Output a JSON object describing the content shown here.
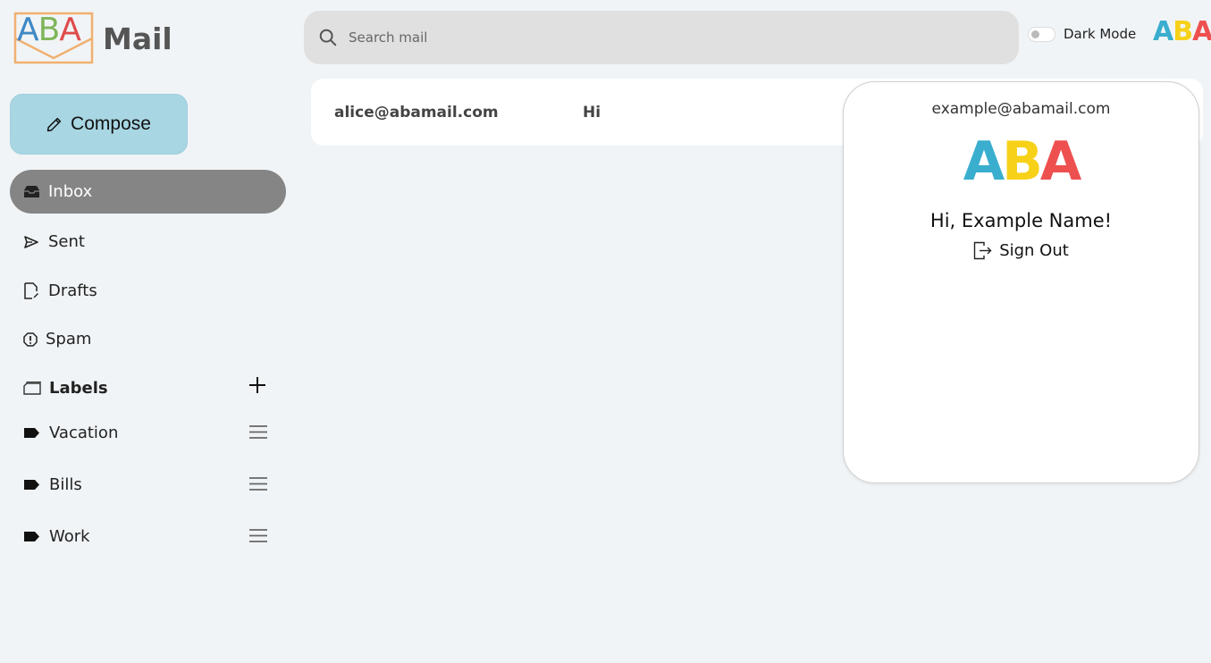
{
  "app": {
    "logo_letters": [
      "A",
      "B",
      "A"
    ],
    "logo_word": "Mail"
  },
  "search": {
    "placeholder": "Search mail"
  },
  "theme": {
    "dark_mode_label": "Dark Mode",
    "dark_mode_on": false
  },
  "account_avatar_letters": [
    "A",
    "B",
    "A"
  ],
  "sidebar": {
    "compose_label": "Compose",
    "items": [
      {
        "label": "Inbox",
        "icon": "inbox-icon",
        "active": true
      },
      {
        "label": "Sent",
        "icon": "send-icon",
        "active": false
      },
      {
        "label": "Drafts",
        "icon": "draft-icon",
        "active": false
      },
      {
        "label": "Spam",
        "icon": "spam-icon",
        "active": false
      }
    ],
    "labels_title": "Labels",
    "labels": [
      {
        "label": "Vacation"
      },
      {
        "label": "Bills"
      },
      {
        "label": "Work"
      }
    ]
  },
  "mail": {
    "messages": [
      {
        "from": "alice@abamail.com",
        "subject": "Hi"
      }
    ]
  },
  "account_popup": {
    "email": "example@abamail.com",
    "logo_letters": [
      "A",
      "B",
      "A"
    ],
    "greeting": "Hi, Example Name!",
    "sign_out_label": "Sign Out"
  },
  "colors": {
    "background": "#f1f4f6",
    "compose": "#a8d6e3",
    "active_nav": "#858585",
    "search_bg": "#e1e0e1",
    "logo_blue": "#3aaecf",
    "logo_yellow": "#f7d117",
    "logo_red": "#ee5050"
  }
}
